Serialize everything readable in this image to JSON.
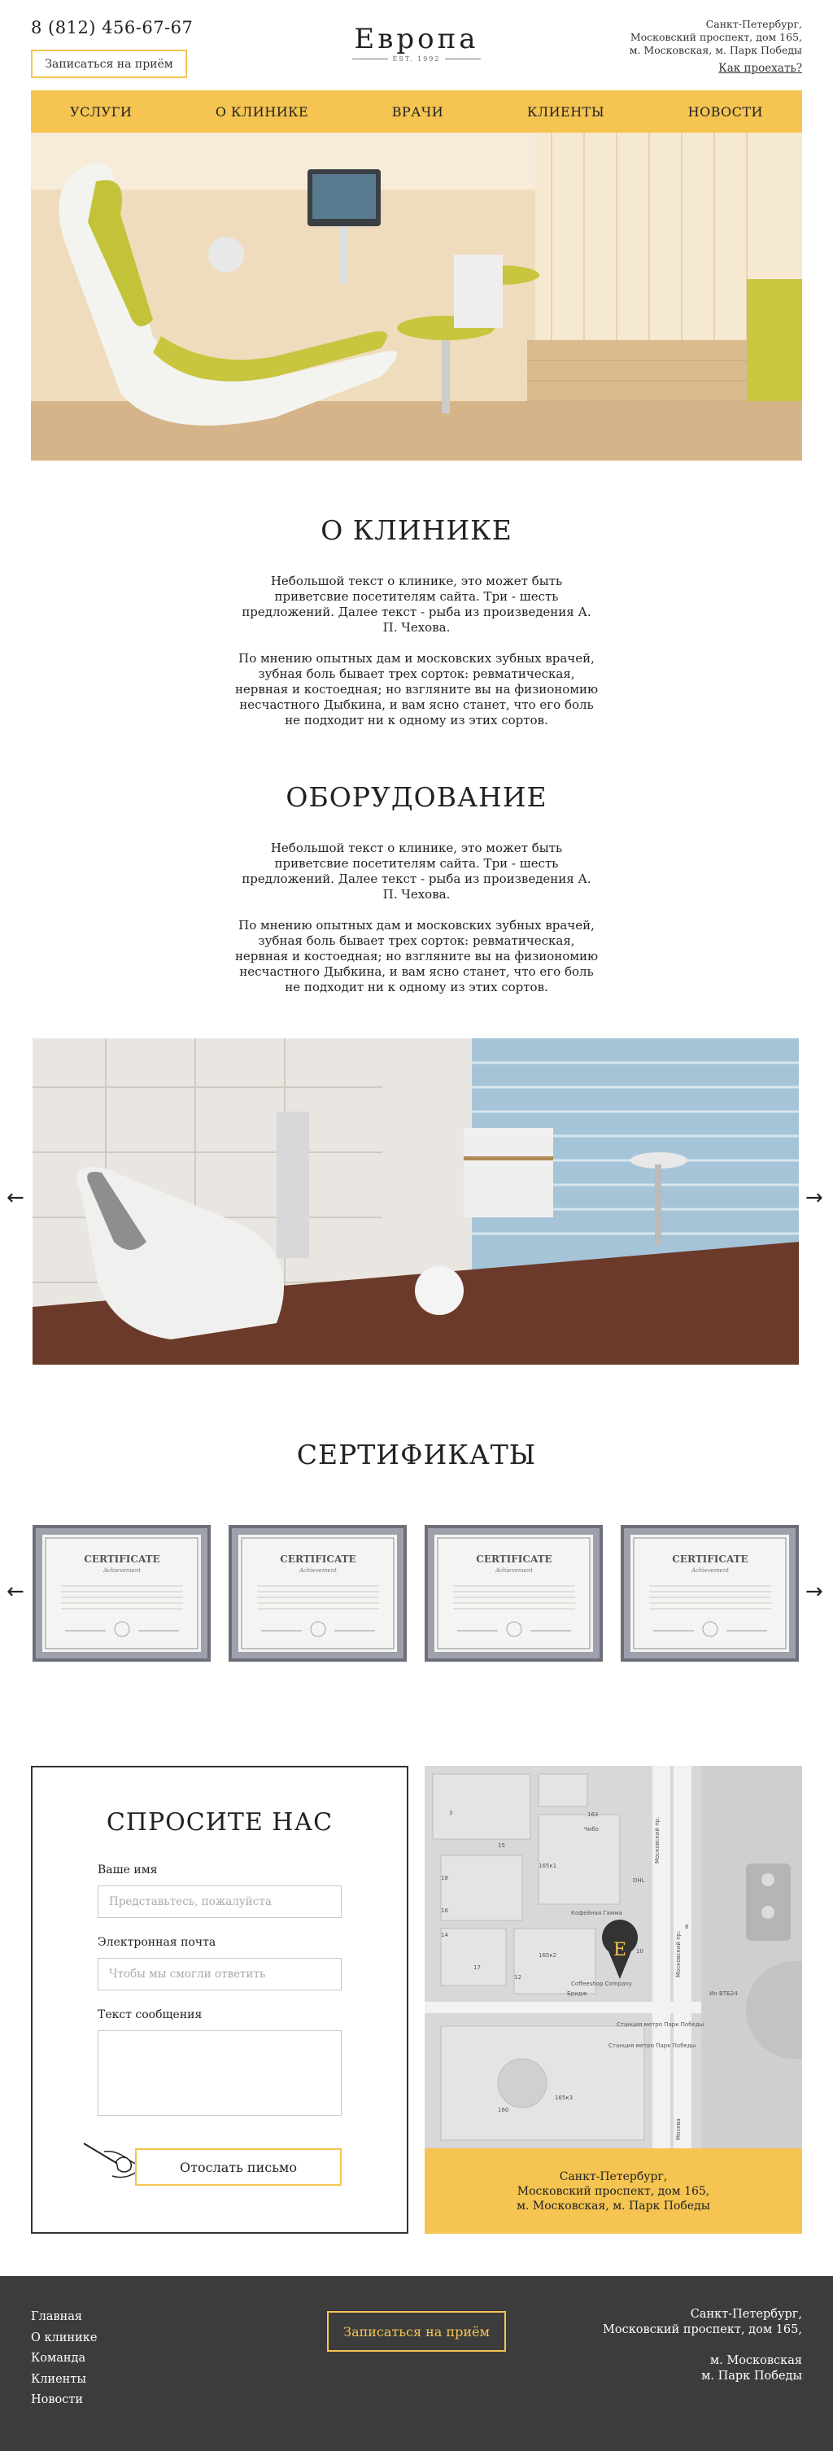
{
  "header": {
    "phone": "8 (812) 456-67-67",
    "appointment_button": "Записаться на приём",
    "logo_name": "Европа",
    "logo_est": "EST. 1992",
    "address_lines": [
      "Санкт-Петербург,",
      "Московский проспект, дом 165,",
      "м. Московская, м. Парк Победы"
    ],
    "route_link": "Как проехать?"
  },
  "nav": {
    "items": [
      "УСЛУГИ",
      "О КЛИНИКЕ",
      "ВРАЧИ",
      "КЛИЕНТЫ",
      "НОВОСТИ"
    ]
  },
  "about": {
    "title": "О КЛИНИКЕ",
    "paragraph1": "Небольшой текст о клинике, это может быть приветсвие посетителям сайта. Три - шесть предложений. Далее текст - рыба из произведения А. П. Чехова.",
    "paragraph2": "По мнению опытных дам и московских зубных врачей, зубная боль бывает трех сорток: ревматическая, нервная и костоедная; но взгляните вы на физиономию несчастного Дыбкина, и вам ясно станет, что его боль не подходит ни к одному из этих сортов."
  },
  "equipment": {
    "title": "ОБОРУДОВАНИЕ",
    "paragraph1": "Небольшой текст о клинике, это может быть приветсвие посетителям сайта. Три - шесть предложений. Далее текст - рыба из произведения А. П. Чехова.",
    "paragraph2": "По мнению опытных дам и московских зубных врачей, зубная боль бывает трех сорток: ревматическая, нервная и костоедная; но взгляните вы на физиономию несчастного Дыбкина, и вам ясно станет, что его боль не подходит ни к одному из этих сортов.",
    "arrow_left": "←",
    "arrow_right": "→"
  },
  "certificates": {
    "title": "СЕРТИФИКАТЫ",
    "cert_heading": "CERTIFICATE",
    "cert_sub": "Achievement",
    "count": 4,
    "arrow_left": "←",
    "arrow_right": "→"
  },
  "contact": {
    "title": "СПРОСИТЕ НАС",
    "name_label": "Ваше имя",
    "name_placeholder": "Представьтесь, пожалуйста",
    "email_label": "Электронная почта",
    "email_placeholder": "Чтобы мы смогли ответить",
    "message_label": "Текст сообщения",
    "send_button": "Отослать письмо"
  },
  "map": {
    "marker_letter": "E",
    "address_lines": [
      "Санкт-Петербург,",
      "Московский проспект, дом 165,",
      "м. Московская, м. Парк Победы"
    ],
    "labels": {
      "street1": "Московский пр.",
      "street2": "Московский пр.",
      "poi1": "Кофейная Гамма",
      "poi2": "Coffeeshop Company",
      "poi3": "Бридж",
      "poi4": "Станция метро Парк Победы",
      "poi5": "Станция метро Парк Победы",
      "poi6": "Чибо",
      "poi7": "DHL",
      "poi8": "Ин ВТБ24",
      "num1": "165к1",
      "num2": "165к2",
      "num3": "160",
      "num4": "163",
      "num5": "18",
      "num6": "16",
      "num7": "15",
      "num8": "14",
      "num9": "17",
      "num10": "12",
      "num11": "10",
      "num12": "3",
      "num13": "8",
      "num14": "165к3",
      "num15": "Москва"
    }
  },
  "footer": {
    "links": [
      "Главная",
      "О клинике",
      "Команда",
      "Клиенты",
      "Новости"
    ],
    "appointment_button": "Записаться на приём",
    "address_lines": [
      "Санкт-Петербург,",
      "Московский проспект, дом 165,"
    ],
    "metro_lines": [
      "м. Московская",
      "м. Парк Победы"
    ]
  },
  "colors": {
    "accent": "#f5c451",
    "footer_bg": "#3c3c3c",
    "text": "#222222"
  }
}
